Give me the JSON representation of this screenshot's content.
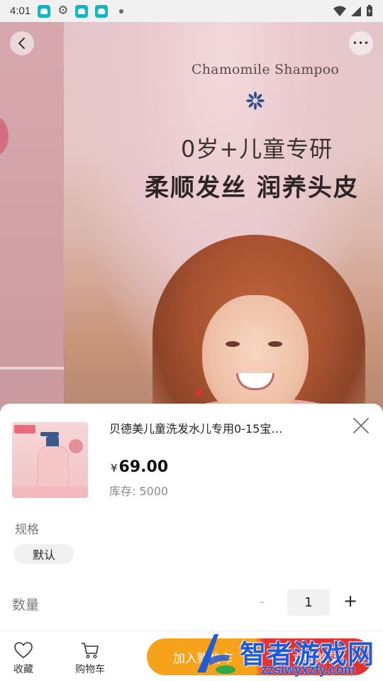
{
  "status_bar": {
    "time": "4:01",
    "icons": [
      "app-notification-icon",
      "settings-gear-icon",
      "app-notification-icon",
      "app-notification-icon",
      "dot-indicator",
      "wifi-icon",
      "signal-icon",
      "battery-icon"
    ]
  },
  "banner": {
    "eyebrow": "Chamomile Shampoo",
    "headline1": "0岁+儿童专研",
    "headline2": "柔顺发丝 润养头皮",
    "back_icon": "chevron-left-icon",
    "more_icon": "more-dots-icon",
    "more_label": "•••"
  },
  "product": {
    "name": "贝德美儿童洗发水儿专用0-15宝…",
    "currency": "¥",
    "price": "69.00",
    "stock": "库存: 5000"
  },
  "spec": {
    "label": "规格",
    "selected": "默认"
  },
  "quantity": {
    "label": "数量",
    "minus": "-",
    "value": "1",
    "plus": "+"
  },
  "bottom_bar": {
    "favorite_label": "收藏",
    "cart_label": "购物车",
    "add_to_cart": "加入购物车",
    "buy_now": "立即购买"
  },
  "watermark": {
    "text": "智者游戏网",
    "url": "zzsiwyxzfy.com"
  },
  "colors": {
    "cta_orange": "#f7a21b",
    "cta_red": "#e03030",
    "price_text": "#111111",
    "pager_active": "#e0313b",
    "watermark_blue": "#1e5bd8"
  }
}
